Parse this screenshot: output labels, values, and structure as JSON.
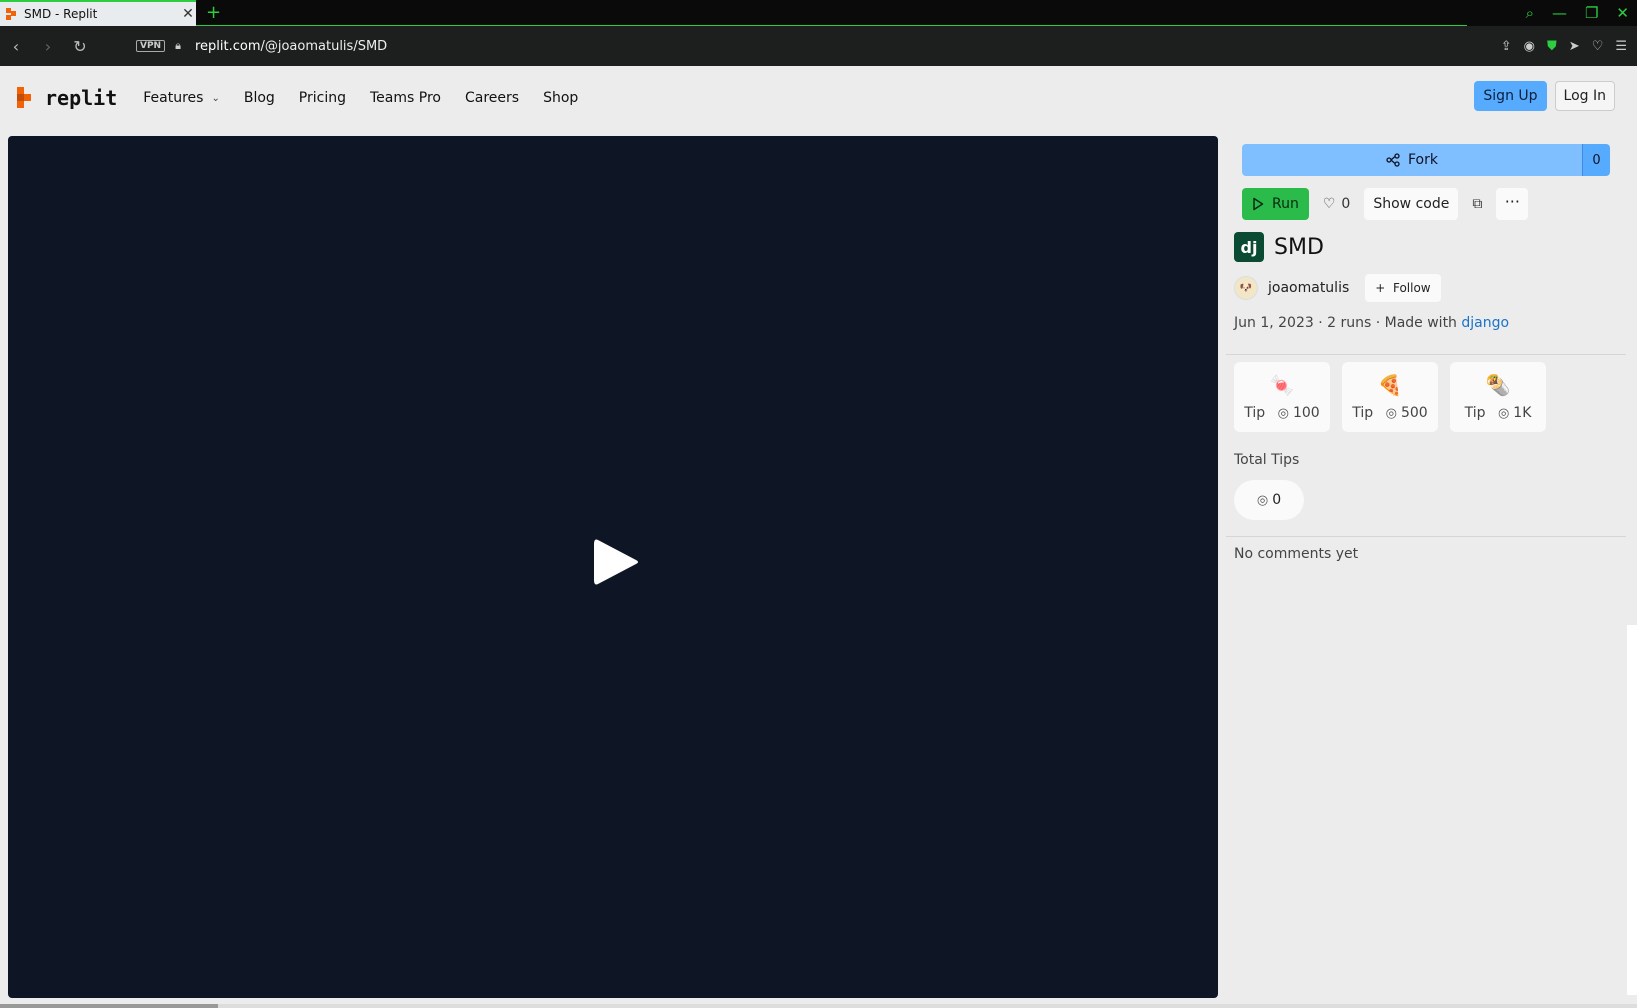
{
  "browser": {
    "tab_title": "SMD - Replit",
    "tab_close": "✕",
    "new_tab": "+",
    "vpn_label": "VPN",
    "url_host": "replit.com",
    "url_path": "/@joaomatulis/SMD"
  },
  "nav": {
    "logo_text": "replit",
    "links": [
      "Features",
      "Blog",
      "Pricing",
      "Teams Pro",
      "Careers",
      "Shop"
    ],
    "signup": "Sign Up",
    "login": "Log In"
  },
  "repl": {
    "fork_label": "Fork",
    "fork_count": "0",
    "run_label": "Run",
    "likes": "0",
    "show_code": "Show code",
    "more": "···",
    "title": "SMD",
    "lang_icon_text": "dj",
    "author": "joaomatulis",
    "follow": "Follow",
    "meta_prefix": "Jun 1, 2023 · 2 runs · Made with ",
    "meta_link": "django",
    "tips": [
      {
        "emoji": "🍬",
        "label": "Tip",
        "amount": "100"
      },
      {
        "emoji": "🍕",
        "label": "Tip",
        "amount": "500"
      },
      {
        "emoji": "🌯",
        "label": "Tip",
        "amount": "1K"
      }
    ],
    "total_tips_label": "Total Tips",
    "total_tips_value": "0",
    "comments_text": "No comments yet"
  },
  "colors": {
    "brand_orange": "#F26207",
    "player_bg": "#0E1525",
    "run_green": "#2ABB4A",
    "fork_blue": "#7FBFFF",
    "signup_blue": "#57ABFF"
  }
}
